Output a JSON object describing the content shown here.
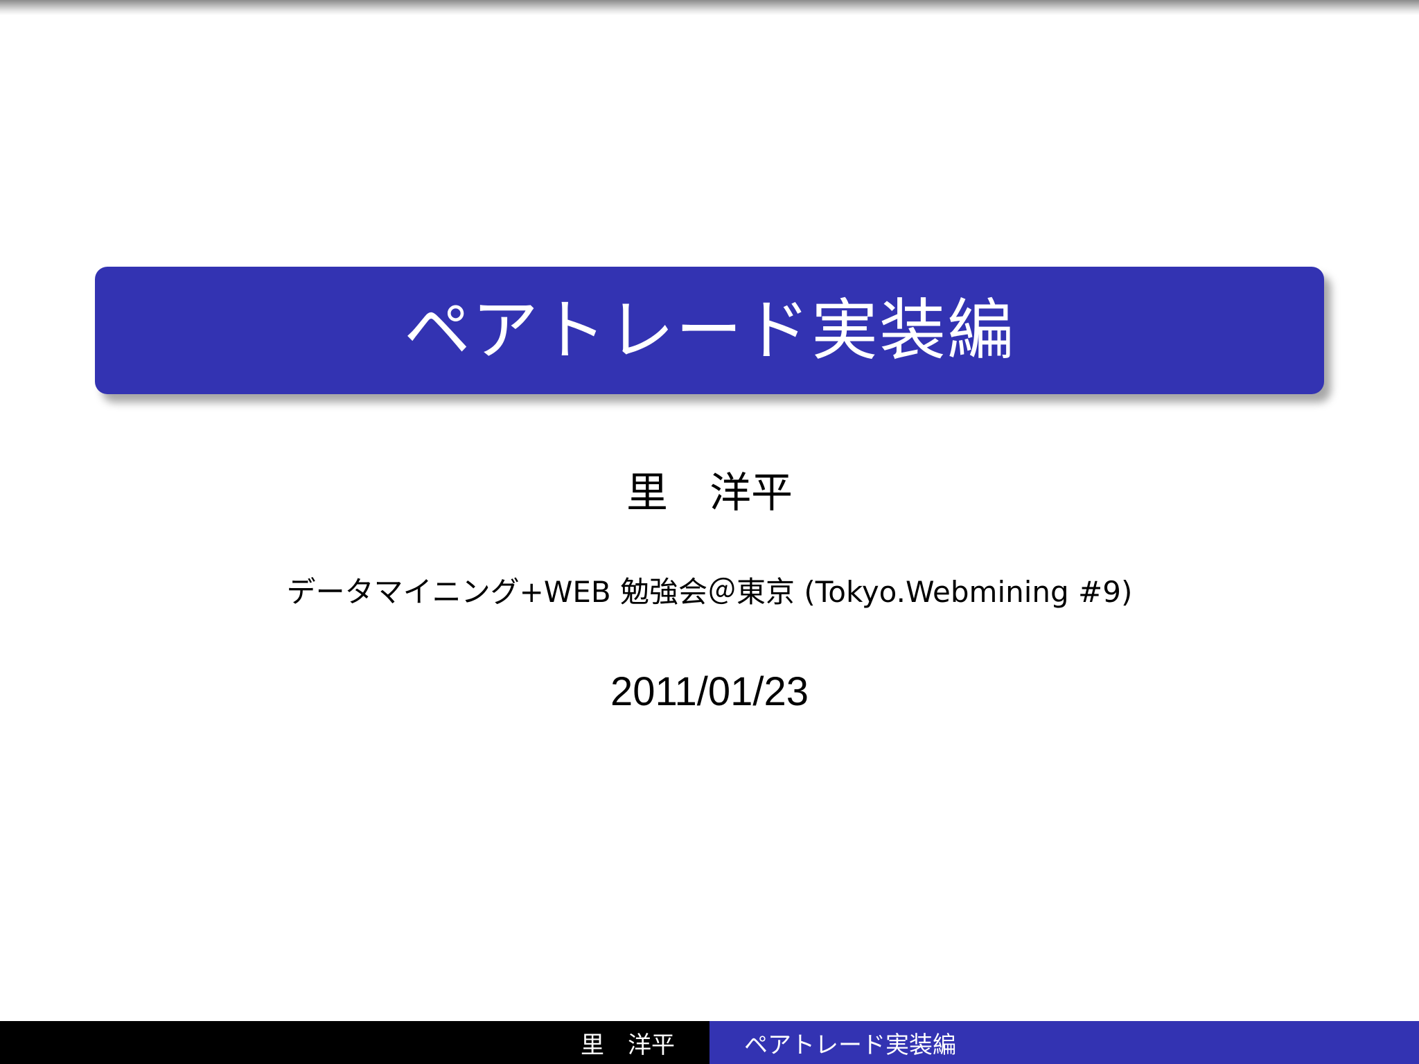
{
  "slide": {
    "title": "ペアトレード実装編",
    "author": "里　洋平",
    "institute": "データマイニング+WEB 勉強会＠東京 (Tokyo.Webmining #9)",
    "date": "2011/01/23"
  },
  "footer": {
    "author": "里　洋平",
    "title": "ペアトレード実装編"
  },
  "colors": {
    "accent": "#3333b2",
    "footer_left_bg": "#000000",
    "text": "#000000"
  }
}
